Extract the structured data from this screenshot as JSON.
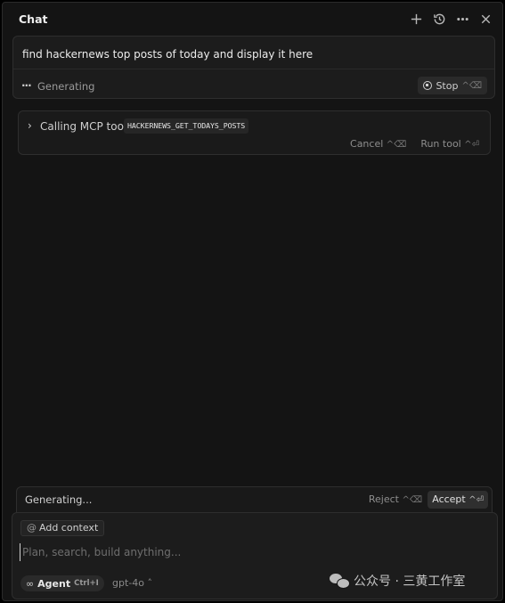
{
  "header": {
    "title": "Chat",
    "icons": [
      "plus-icon",
      "history-icon",
      "more-icon",
      "close-icon"
    ]
  },
  "message": {
    "text": "find hackernews top posts of today and display it here",
    "status": "Generating",
    "stop_label": "Stop",
    "stop_shortcut": "^⌫"
  },
  "tool_call": {
    "label": "Calling MCP tool",
    "tool_name": "HACKERNEWS_GET_TODAYS_POSTS",
    "cancel_label": "Cancel",
    "cancel_shortcut": "^⌫",
    "run_label": "Run tool",
    "run_shortcut": "^⏎"
  },
  "generating_bar": {
    "text": "Generating...",
    "reject_label": "Reject",
    "reject_shortcut": "^⌫",
    "accept_label": "Accept",
    "accept_shortcut": "^⏎"
  },
  "composer": {
    "add_context_label": "Add context",
    "placeholder": "Plan, search, build anything...",
    "value": "",
    "agent_label": "Agent",
    "agent_shortcut": "Ctrl+I",
    "model_label": "gpt-4o"
  },
  "watermark": {
    "text": "公众号 · 三黄工作室"
  }
}
